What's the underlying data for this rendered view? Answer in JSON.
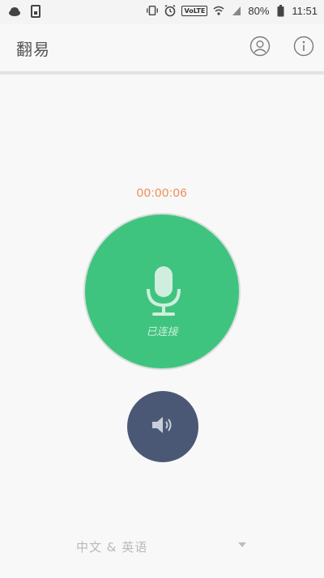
{
  "status_bar": {
    "left_icons": [
      "cloud-icon",
      "sim-icon"
    ],
    "right_icons": [
      "vibrate-icon",
      "alarm-icon",
      "volte-icon",
      "wifi-icon",
      "signal-icon",
      "battery-icon"
    ],
    "volte": "VoLTE",
    "battery": "80%",
    "time": "11:51"
  },
  "app_bar": {
    "title": "翻易",
    "icons": [
      "user-icon",
      "info-icon"
    ]
  },
  "call": {
    "timer": "00:00:06",
    "mic_status": "已连接",
    "mic_color": "#3fc480",
    "speaker_color": "#4b5875",
    "timer_color": "#ef8a55"
  },
  "language": {
    "selected": "中文 & 英语"
  }
}
